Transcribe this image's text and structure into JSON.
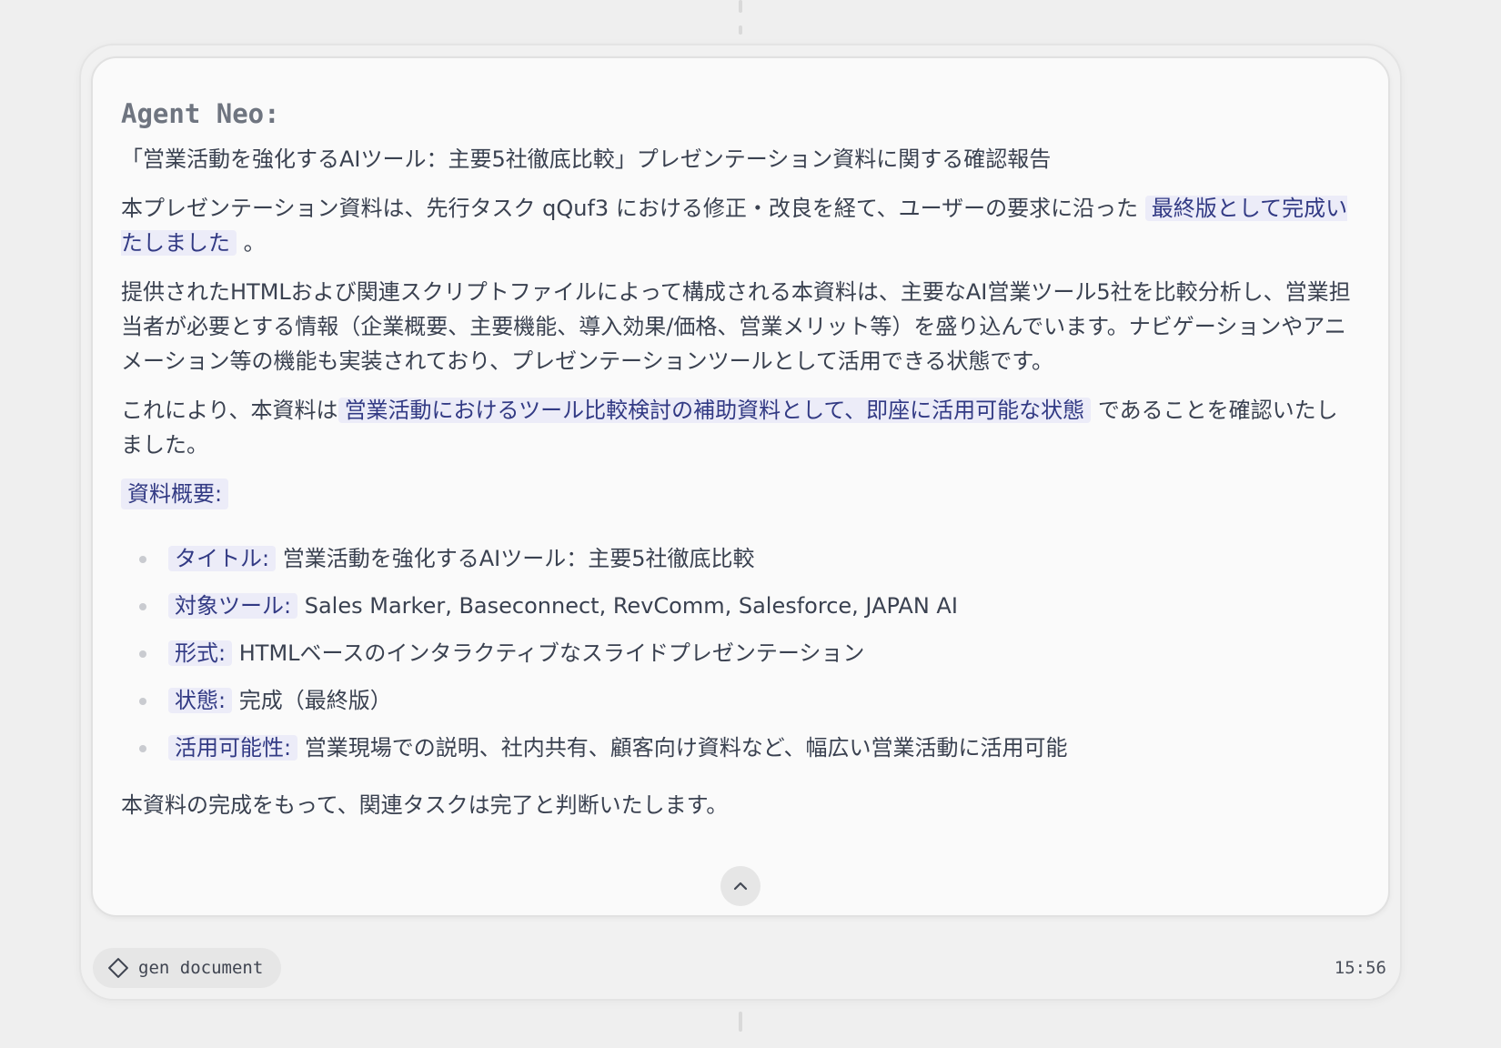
{
  "message": {
    "agent_name": "Agent Neo:",
    "title": "「営業活動を強化するAIツール：主要5社徹底比較」プレゼンテーション資料に関する確認報告",
    "p1_before": "本プレゼンテーション資料は、先行タスク qQuf3 における修正・改良を経て、ユーザーの要求に沿った",
    "p1_highlight": "最終版として完成いたしました",
    "p1_after": "。",
    "p2": "提供されたHTMLおよび関連スクリプトファイルによって構成される本資料は、主要なAI営業ツール5社を比較分析し、営業担当者が必要とする情報（企業概要、主要機能、導入効果/価格、営業メリット等）を盛り込んでいます。ナビゲーションやアニメーション等の機能も実装されており、プレゼンテーションツールとして活用できる状態です。",
    "p3_before": "これにより、本資料は",
    "p3_highlight": "営業活動におけるツール比較検討の補助資料として、即座に活用可能な状態",
    "p3_after": "であることを確認いたしました。",
    "section_label": "資料概要:",
    "summary_items": [
      {
        "label": "タイトル:",
        "value": "営業活動を強化するAIツール：主要5社徹底比較"
      },
      {
        "label": "対象ツール:",
        "value": "Sales Marker, Baseconnect, RevComm, Salesforce, JAPAN AI"
      },
      {
        "label": "形式:",
        "value": "HTMLベースのインタラクティブなスライドプレゼンテーション"
      },
      {
        "label": "状態:",
        "value": "完成（最終版）"
      },
      {
        "label": "活用可能性:",
        "value": "営業現場での説明、社内共有、顧客向け資料など、幅広い営業活動に活用可能"
      }
    ],
    "closing": "本資料の完成をもって、関連タスクは完了と判断いたします。"
  },
  "footer": {
    "tool_label": "gen document",
    "tool_icon": "diamond-icon",
    "timestamp": "15:56"
  },
  "icons": {
    "collapse": "chevron-up-icon"
  },
  "colors": {
    "highlight_bg": "#ececf8",
    "highlight_text": "#323a84",
    "body_text": "#3a4150"
  }
}
